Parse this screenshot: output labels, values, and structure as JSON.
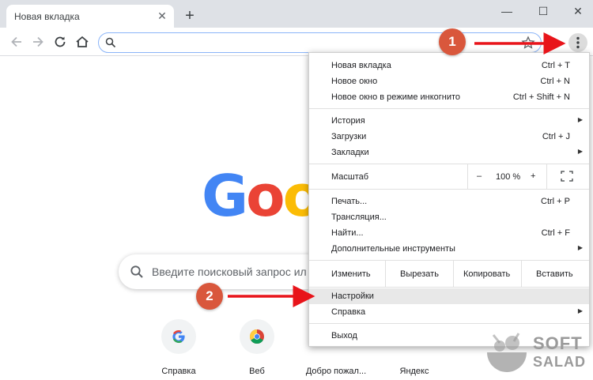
{
  "tab": {
    "title": "Новая вкладка"
  },
  "menu": {
    "items": [
      {
        "label": "Новая вкладка",
        "shortcut": "Ctrl + T"
      },
      {
        "label": "Новое окно",
        "shortcut": "Ctrl + N"
      },
      {
        "label": "Новое окно в режиме инкогнито",
        "shortcut": "Ctrl + Shift + N"
      },
      {
        "label": "История"
      },
      {
        "label": "Загрузки",
        "shortcut": "Ctrl + J"
      },
      {
        "label": "Закладки"
      },
      {
        "label": "Печать...",
        "shortcut": "Ctrl + P"
      },
      {
        "label": "Трансляция..."
      },
      {
        "label": "Найти...",
        "shortcut": "Ctrl + F"
      },
      {
        "label": "Дополнительные инструменты"
      },
      {
        "label": "Настройки"
      },
      {
        "label": "Справка"
      },
      {
        "label": "Выход"
      }
    ],
    "zoom": {
      "label": "Масштаб",
      "minus": "–",
      "value": "100 %",
      "plus": "+"
    },
    "edit": {
      "label": "Изменить",
      "cut": "Вырезать",
      "copy": "Копировать",
      "paste": "Вставить"
    }
  },
  "logo": {
    "g1": "G",
    "o1": "o",
    "o2": "o"
  },
  "search": {
    "placeholder": "Введите поисковый запрос ил"
  },
  "shortcuts": [
    {
      "label": "Справка"
    },
    {
      "label": "Веб"
    },
    {
      "label": "Добро пожал..."
    },
    {
      "label": "Яндекс"
    }
  ],
  "badges": {
    "one": "1",
    "two": "2"
  },
  "watermark": {
    "line1": "SOFT",
    "line2": "SALAD"
  },
  "colors": {
    "annotation": "#d9573c",
    "arrow": "#e8141a",
    "omnibox_focus": "#8ab4f8"
  }
}
